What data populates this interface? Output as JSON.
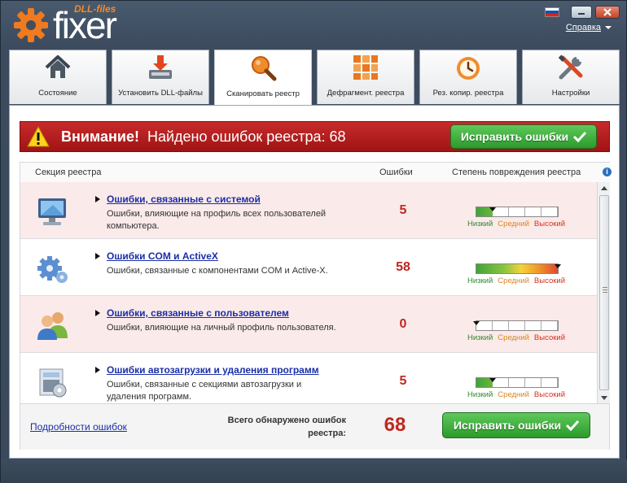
{
  "app": {
    "logo_small": "DLL-files",
    "logo_big": "fixer",
    "help_label": "Справка",
    "flag_colors": [
      "#ffffff",
      "#1d4fb5",
      "#d62618"
    ]
  },
  "tabs": [
    {
      "label": "Состояние",
      "icon": "house-icon",
      "active": false
    },
    {
      "label": "Установить DLL-файлы",
      "icon": "download-icon",
      "active": false
    },
    {
      "label": "Сканировать реестр",
      "icon": "magnifier-icon",
      "active": true
    },
    {
      "label": "Дефрагмент. реестра",
      "icon": "blocks-icon",
      "active": false
    },
    {
      "label": "Рез. копир. реестра",
      "icon": "clock-icon",
      "active": false
    },
    {
      "label": "Настройки",
      "icon": "tools-icon",
      "active": false
    }
  ],
  "alert": {
    "title": "Внимание!",
    "text": "Найдено ошибок реестра: 68",
    "button": "Исправить ошибки"
  },
  "table": {
    "col_section": "Секция реестра",
    "col_errors": "Ошибки",
    "col_severity": "Степень повреждения реестра",
    "severity_low": "Низкий",
    "severity_mid": "Средний",
    "severity_high": "Высокий",
    "rows": [
      {
        "title": "Ошибки, связанные с системой",
        "desc": "Ошибки, влияющие на профиль всех пользователей компьютера.",
        "count": "5",
        "severity": 0.2,
        "icon": "monitor-icon"
      },
      {
        "title": "Ошибки COM и ActiveX",
        "desc": "Ошибки, связанные с компонентами COM и Active-X.",
        "count": "58",
        "severity": 1.0,
        "icon": "gears-icon"
      },
      {
        "title": "Ошибки, связанные с пользователем",
        "desc": "Ошибки, влияющие на личный профиль пользователя.",
        "count": "0",
        "severity": 0.0,
        "icon": "users-icon"
      },
      {
        "title": "Ошибки автозагрузки и удаления программ",
        "desc": "Ошибки, связанные с секциями автозагрузки и удаления программ.",
        "count": "5",
        "severity": 0.2,
        "icon": "installer-icon"
      }
    ]
  },
  "footer": {
    "details_link": "Подробности ошибок",
    "total_label": "Всего обнаружено ошибок реестра:",
    "total_value": "68",
    "button": "Исправить ошибки"
  }
}
